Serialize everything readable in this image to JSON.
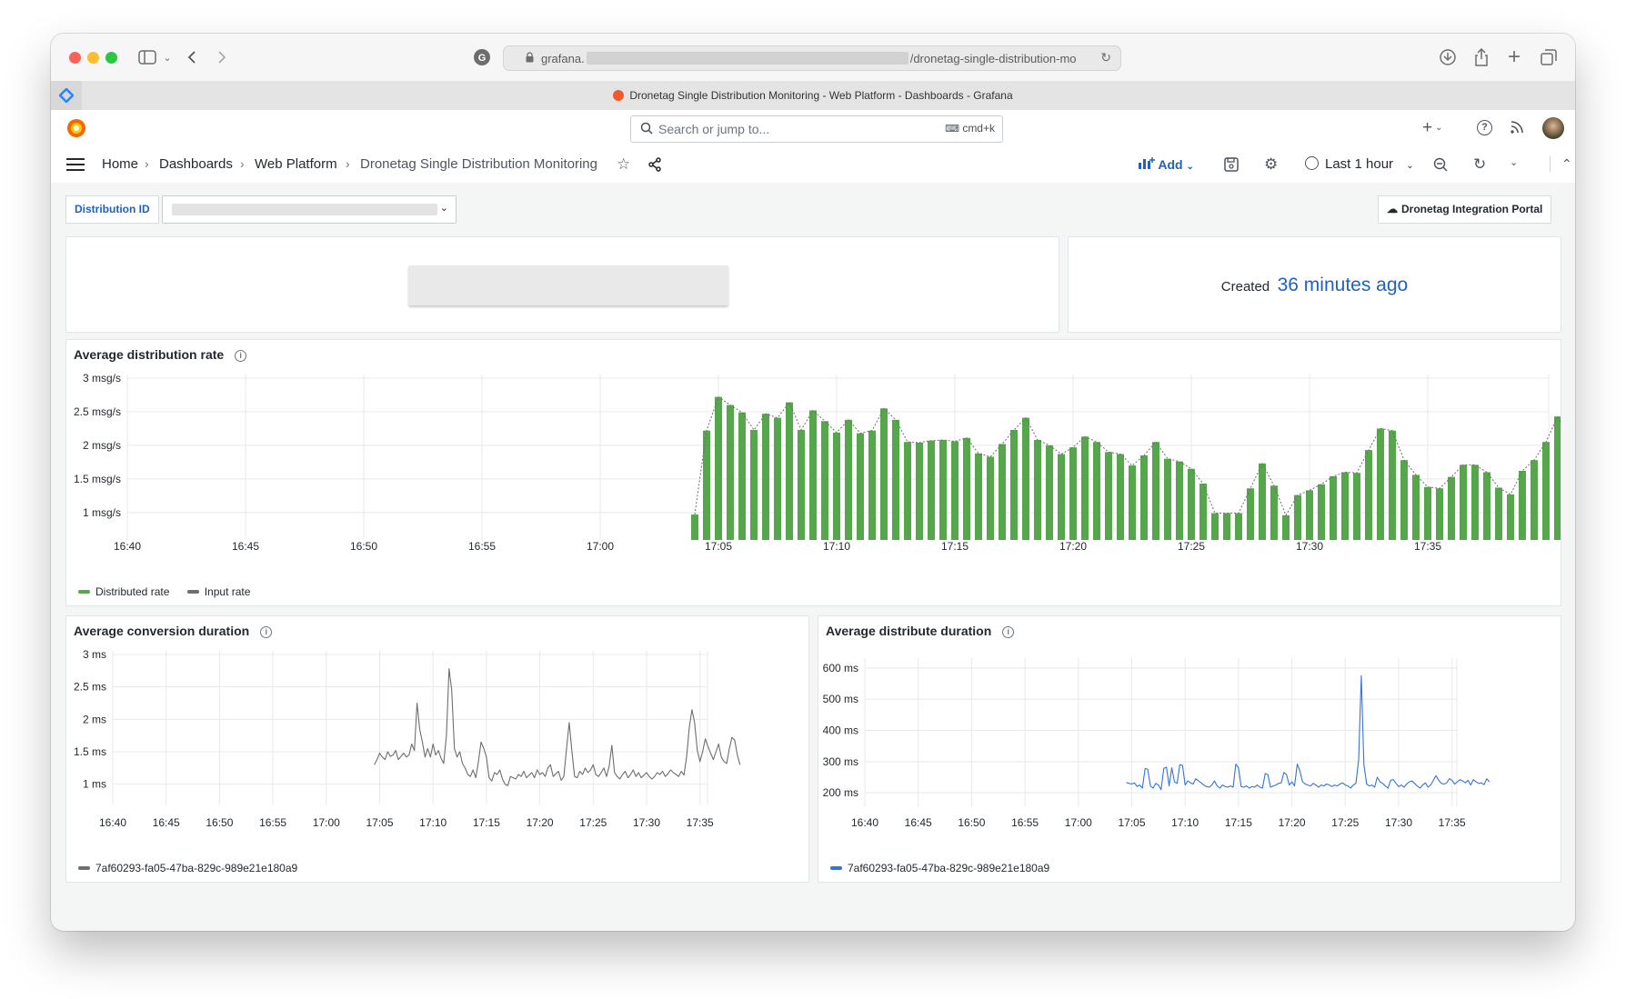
{
  "browser": {
    "url_prefix": "grafana.",
    "url_suffix": "/dronetag-single-distribution-mo",
    "tab_title": "Dronetag Single Distribution Monitoring - Web Platform - Dashboards - Grafana"
  },
  "topbar": {
    "search_placeholder": "Search or jump to...",
    "search_shortcut": "cmd+k"
  },
  "breadcrumb": {
    "home": "Home",
    "dashboards": "Dashboards",
    "folder": "Web Platform",
    "current": "Dronetag Single Distribution Monitoring"
  },
  "nav_actions": {
    "add_label": "Add",
    "time_range": "Last 1 hour"
  },
  "variables": {
    "label": "Distribution ID",
    "value": ""
  },
  "portal_button": "Dronetag Integration Portal",
  "created": {
    "label": "Created",
    "value": "36 minutes ago"
  },
  "colors": {
    "green": "#56a64b",
    "blue": "#3274d9",
    "gray": "#6e6e6e",
    "accent": "#1f60c4"
  },
  "panels": {
    "rate_title": "Average distribution rate",
    "conv_title": "Average conversion duration",
    "dist_title": "Average distribute duration"
  },
  "chart_data": [
    {
      "type": "bar",
      "title": "Average distribution rate",
      "y_unit": "msg/s",
      "ylim": [
        0.7,
        3
      ],
      "y_ticks": [
        "3 msg/s",
        "2.5 msg/s",
        "2 msg/s",
        "1.5 msg/s",
        "1 msg/s"
      ],
      "x_ticks": [
        "16:40",
        "16:45",
        "16:50",
        "16:55",
        "17:00",
        "17:05",
        "17:10",
        "17:15",
        "17:20",
        "17:25",
        "17:30",
        "17:35"
      ],
      "x_start": "16:40",
      "bar_interval_sec": 30,
      "first_bar": "17:04",
      "series": [
        {
          "name": "Distributed rate",
          "color": "#56a64b",
          "values": [
            0.97,
            2.22,
            2.72,
            2.6,
            2.49,
            2.23,
            2.47,
            2.41,
            2.64,
            2.23,
            2.52,
            2.36,
            2.19,
            2.38,
            2.18,
            2.22,
            2.55,
            2.38,
            2.05,
            2.04,
            2.07,
            2.08,
            2.06,
            2.11,
            1.88,
            1.83,
            2.02,
            2.23,
            2.41,
            2.08,
            2.0,
            1.87,
            1.97,
            2.13,
            2.05,
            1.9,
            1.87,
            1.7,
            1.85,
            2.05,
            1.8,
            1.76,
            1.65,
            1.43,
            0.99,
            0.99,
            0.99,
            1.36,
            1.73,
            1.4,
            0.96,
            1.26,
            1.33,
            1.42,
            1.54,
            1.6,
            1.59,
            1.93,
            2.25,
            2.22,
            1.78,
            1.56,
            1.38,
            1.36,
            1.53,
            1.71,
            1.71,
            1.6,
            1.37,
            1.27,
            1.62,
            1.78,
            2.05,
            2.43,
            2.06
          ]
        },
        {
          "name": "Input rate",
          "color": "#6e6e6e",
          "values": [
            0.97,
            2.22,
            2.72,
            2.6,
            2.49,
            2.23,
            2.47,
            2.41,
            2.64,
            2.23,
            2.52,
            2.36,
            2.19,
            2.38,
            2.18,
            2.22,
            2.55,
            2.38,
            2.05,
            2.04,
            2.07,
            2.08,
            2.06,
            2.11,
            1.88,
            1.83,
            2.02,
            2.23,
            2.41,
            2.08,
            2.0,
            1.87,
            1.97,
            2.13,
            2.05,
            1.9,
            1.87,
            1.7,
            1.85,
            2.05,
            1.8,
            1.76,
            1.65,
            1.43,
            0.99,
            0.99,
            0.99,
            1.36,
            1.73,
            1.4,
            0.96,
            1.26,
            1.33,
            1.42,
            1.54,
            1.6,
            1.59,
            1.93,
            2.25,
            2.22,
            1.78,
            1.56,
            1.38,
            1.36,
            1.53,
            1.71,
            1.71,
            1.6,
            1.37,
            1.27,
            1.62,
            1.78,
            2.05,
            2.43,
            2.06
          ]
        }
      ],
      "legend": "bottom-left",
      "grid": true
    },
    {
      "type": "line",
      "title": "Average conversion duration",
      "y_unit": "ms",
      "ylim": [
        0.8,
        3
      ],
      "y_ticks": [
        "3 ms",
        "2.5 ms",
        "2 ms",
        "1.5 ms",
        "1 ms"
      ],
      "x_ticks": [
        "16:40",
        "16:45",
        "16:50",
        "16:55",
        "17:00",
        "17:05",
        "17:10",
        "17:15",
        "17:20",
        "17:25",
        "17:30",
        "17:35"
      ],
      "x_start": "16:40",
      "point_interval_sec": 15,
      "first_point": "17:04:30",
      "series": [
        {
          "name": "7af60293-fa05-47ba-829c-989e21e180a9",
          "color": "#6e6e6e",
          "values": [
            1.3,
            1.38,
            1.48,
            1.42,
            1.38,
            1.5,
            1.43,
            1.45,
            1.52,
            1.38,
            1.43,
            1.48,
            1.42,
            1.45,
            1.62,
            1.52,
            2.25,
            1.85,
            1.65,
            1.42,
            1.55,
            1.42,
            1.62,
            1.45,
            1.52,
            1.4,
            1.32,
            1.75,
            2.78,
            2.45,
            1.55,
            1.42,
            1.5,
            1.32,
            1.25,
            1.15,
            1.12,
            1.22,
            1.1,
            1.35,
            1.65,
            1.55,
            1.42,
            1.1,
            1.05,
            1.18,
            1.15,
            1.22,
            1.08,
            1.0,
            0.98,
            1.12,
            1.1,
            1.08,
            1.15,
            1.12,
            1.2,
            1.1,
            1.14,
            1.18,
            1.1,
            1.22,
            1.15,
            1.18,
            1.12,
            1.25,
            1.3,
            1.12,
            1.16,
            1.2,
            1.06,
            1.12,
            1.55,
            1.95,
            1.52,
            1.12,
            1.1,
            1.2,
            1.15,
            1.25,
            1.18,
            1.22,
            1.3,
            1.15,
            1.12,
            1.18,
            1.25,
            1.12,
            1.28,
            1.6,
            1.18,
            1.12,
            1.08,
            1.15,
            1.2,
            1.1,
            1.15,
            1.22,
            1.12,
            1.18,
            1.1,
            1.14,
            1.18,
            1.12,
            1.08,
            1.12,
            1.18,
            1.15,
            1.2,
            1.12,
            1.16,
            1.22,
            1.18,
            1.15,
            1.12,
            1.2,
            1.14,
            1.42,
            1.88,
            2.15,
            1.95,
            1.52,
            1.35,
            1.5,
            1.7,
            1.58,
            1.48,
            1.38,
            1.5,
            1.62,
            1.42,
            1.35,
            1.32,
            1.55,
            1.72,
            1.68,
            1.45,
            1.3
          ]
        }
      ],
      "legend": "bottom-left",
      "grid": true
    },
    {
      "type": "line",
      "title": "Average distribute duration",
      "y_unit": "ms",
      "ylim": [
        180,
        620
      ],
      "y_ticks": [
        "600 ms",
        "500 ms",
        "400 ms",
        "300 ms",
        "200 ms"
      ],
      "x_ticks": [
        "16:40",
        "16:45",
        "16:50",
        "16:55",
        "17:00",
        "17:05",
        "17:10",
        "17:15",
        "17:20",
        "17:25",
        "17:30",
        "17:35"
      ],
      "x_start": "16:40",
      "point_interval_sec": 15,
      "first_point": "17:04:30",
      "series": [
        {
          "name": "7af60293-fa05-47ba-829c-989e21e180a9",
          "color": "#3274d9",
          "values": [
            233,
            230,
            228,
            232,
            220,
            225,
            215,
            278,
            275,
            222,
            215,
            230,
            225,
            210,
            278,
            282,
            222,
            280,
            235,
            230,
            290,
            288,
            225,
            238,
            232,
            228,
            245,
            238,
            232,
            225,
            220,
            218,
            225,
            238,
            222,
            215,
            225,
            220,
            218,
            222,
            218,
            292,
            280,
            220,
            218,
            222,
            215,
            220,
            218,
            225,
            218,
            215,
            262,
            258,
            218,
            222,
            225,
            230,
            232,
            265,
            258,
            225,
            235,
            222,
            292,
            270,
            235,
            228,
            225,
            222,
            230,
            225,
            218,
            225,
            222,
            228,
            225,
            220,
            225,
            222,
            228,
            232,
            225,
            222,
            215,
            225,
            230,
            305,
            575,
            290,
            228,
            222,
            225,
            218,
            250,
            235,
            230,
            222,
            215,
            240,
            242,
            230,
            220,
            225,
            218,
            228,
            235,
            238,
            230,
            222,
            215,
            225,
            232,
            218,
            225,
            240,
            255,
            240,
            230,
            228,
            232,
            245,
            240,
            228,
            235,
            242,
            238,
            232,
            240,
            225,
            242,
            235,
            230,
            232,
            226,
            245,
            235
          ]
        }
      ],
      "legend": "bottom-left",
      "grid": true
    }
  ]
}
